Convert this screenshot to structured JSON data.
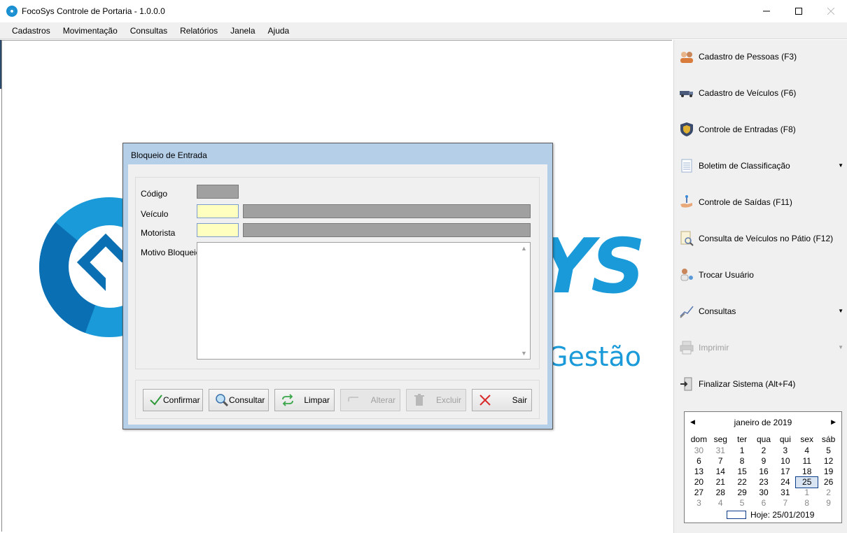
{
  "window": {
    "title": "FocoSys Controle de Portaria - 1.0.0.0"
  },
  "menu": [
    "Cadastros",
    "Movimentação",
    "Consultas",
    "Relatórios",
    "Janela",
    "Ajuda"
  ],
  "logo": {
    "text_sys": "YS",
    "text_gestao": "Gestão"
  },
  "dialog": {
    "title": "Bloqueio de Entrada",
    "fields": {
      "codigo_label": "Código",
      "veiculo_label": "Veículo",
      "motorista_label": "Motorista",
      "motivo_label": "Motivo Bloqueio"
    },
    "buttons": {
      "confirmar": "Confirmar",
      "consultar": "Consultar",
      "limpar": "Limpar",
      "alterar": "Alterar",
      "excluir": "Excluir",
      "sair": "Sair"
    }
  },
  "sidebar": {
    "items": [
      {
        "label": "Cadastro de Pessoas (F3)",
        "icon": "people-icon"
      },
      {
        "label": "Cadastro de Veículos (F6)",
        "icon": "truck-icon"
      },
      {
        "label": "Controle de Entradas (F8)",
        "icon": "shield-icon"
      },
      {
        "label": "Boletim de Classificação",
        "icon": "document-icon"
      },
      {
        "label": "Controle de Saídas (F11)",
        "icon": "hand-exit-icon"
      },
      {
        "label": "Consulta de Veículos no Pátio (F12)",
        "icon": "search-document-icon"
      },
      {
        "label": "Trocar Usuário",
        "icon": "user-switch-icon"
      },
      {
        "label": "Consultas",
        "icon": "chart-icon"
      },
      {
        "label": "Imprimir",
        "icon": "printer-icon"
      },
      {
        "label": "Finalizar Sistema (Alt+F4)",
        "icon": "exit-door-icon"
      }
    ]
  },
  "calendar": {
    "month_label": "janeiro de 2019",
    "weekdays": [
      "dom",
      "seg",
      "ter",
      "qua",
      "qui",
      "sex",
      "sáb"
    ],
    "weeks": [
      [
        "30",
        "31",
        "1",
        "2",
        "3",
        "4",
        "5"
      ],
      [
        "6",
        "7",
        "8",
        "9",
        "10",
        "11",
        "12"
      ],
      [
        "13",
        "14",
        "15",
        "16",
        "17",
        "18",
        "19"
      ],
      [
        "20",
        "21",
        "22",
        "23",
        "24",
        "25",
        "26"
      ],
      [
        "27",
        "28",
        "29",
        "30",
        "31",
        "1",
        "2"
      ],
      [
        "3",
        "4",
        "5",
        "6",
        "7",
        "8",
        "9"
      ]
    ],
    "selected_day": "25",
    "today_label": "Hoje: 25/01/2019"
  }
}
